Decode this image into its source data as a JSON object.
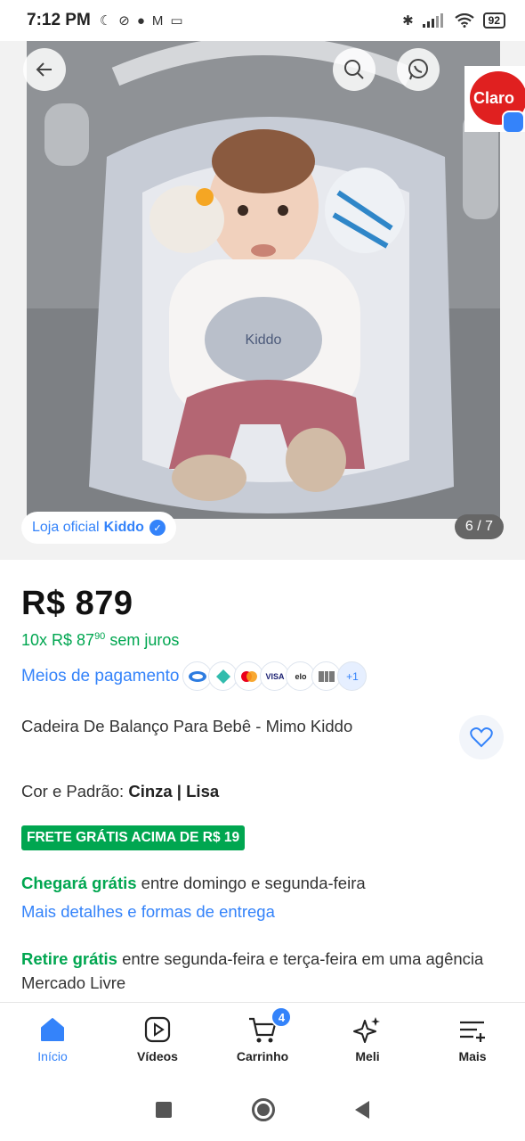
{
  "status_bar": {
    "time": "7:12 PM",
    "battery": "92"
  },
  "gallery": {
    "store_prefix": "Loja oficial",
    "store_name": "Kiddo",
    "counter": "6 / 7",
    "product_brand_print": "Kiddo",
    "ad_badge": "Claro"
  },
  "product": {
    "price": "R$ 879",
    "installments_prefix": "10x R$ 87",
    "installments_cents": "90",
    "installments_suffix": " sem juros",
    "payment_link": "Meios de pagamento",
    "payment_methods": [
      "mercado-pago-icon",
      "pix-icon",
      "mastercard-icon",
      "visa-icon",
      "elo-icon",
      "boleto-icon"
    ],
    "payment_more": "+1",
    "title": "Cadeira De Balanço Para Bebê - Mimo Kiddo",
    "variant_label": "Cor e Padrão: ",
    "variant_value": "Cinza | Lisa",
    "free_shipping_badge": "FRETE GRÁTIS ACIMA DE R$ 19",
    "delivery_highlight": "Chegará grátis",
    "delivery_text": " entre domingo e segunda-feira",
    "delivery_link": "Mais detalhes e formas de entrega",
    "pickup_highlight": "Retire grátis",
    "pickup_text": " entre segunda-feira e terça-feira em uma agência Mercado Livre"
  },
  "bottom_nav": {
    "items": [
      {
        "label": "Início"
      },
      {
        "label": "Vídeos"
      },
      {
        "label": "Carrinho"
      },
      {
        "label": "Meli"
      },
      {
        "label": "Mais"
      }
    ],
    "cart_count": "4"
  },
  "colors": {
    "accent_blue": "#3483fa",
    "green": "#00a650",
    "claro_red": "#e02020"
  }
}
